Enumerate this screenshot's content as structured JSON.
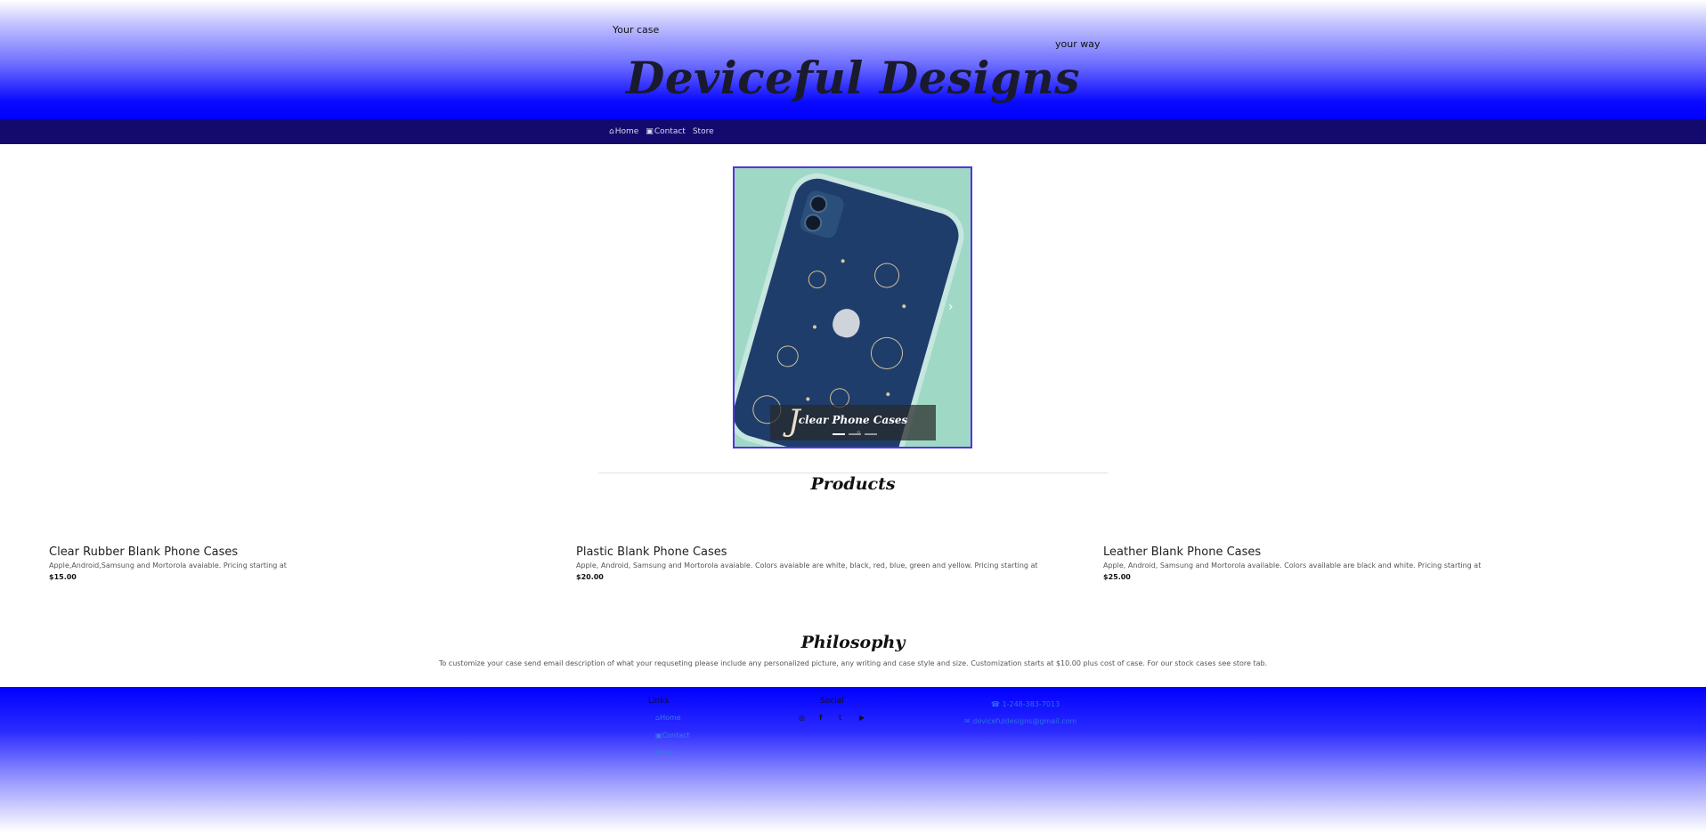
{
  "header": {
    "tagline_left": "Your case",
    "tagline_right": "your way",
    "brand": "Deviceful Designs"
  },
  "nav": {
    "items": [
      {
        "label": "Home",
        "icon": "home-icon"
      },
      {
        "label": "Contact",
        "icon": "contact-card-icon"
      },
      {
        "label": "Store"
      }
    ]
  },
  "carousel": {
    "caption": "clear Phone Cases",
    "caption_glyph": "J",
    "next_glyph": "›",
    "slides": 3,
    "active_slide": 1
  },
  "products": {
    "title": "Products",
    "items": [
      {
        "name": "Clear Rubber Blank Phone Cases",
        "desc": "Apple,Android,Samsung and Mortorola avaiable. Pricing starting at",
        "price": "$15.00"
      },
      {
        "name": "Plastic Blank Phone Cases",
        "desc": "Apple, Android, Samsung and Mortorola avaiable. Colors avaiable are white, black, red, blue, green and yellow. Pricing starting at",
        "price": "$20.00"
      },
      {
        "name": "Leather Blank Phone Cases",
        "desc": "Apple, Android, Samsung and Mortorola available. Colors available are black and white. Pricing starting at",
        "price": "$25.00"
      }
    ]
  },
  "philosophy": {
    "title": "Philosophy",
    "text": "To customize your case send email description of what your requseting please include any personalized picture, any writing and case style and size. Customization starts at $10.00 plus cost of case. For our stock cases see store tab."
  },
  "footer": {
    "links_heading": "Links",
    "links": [
      "Home",
      "Contact",
      "Store"
    ],
    "social_heading": "Social",
    "social_icons": [
      "instagram-icon",
      "facebook-icon",
      "twitter-icon",
      "youtube-icon"
    ],
    "social_glyphs": [
      "◎",
      "f",
      "t",
      "▶"
    ],
    "phone": "1-248-383-7013",
    "email": "devicefuldesigns@gmail.com"
  },
  "colors": {
    "header_blue": "#0000ff",
    "nav_bg": "#140a6e",
    "carousel_border": "#5533dd",
    "link_blue": "#3a7be0"
  }
}
